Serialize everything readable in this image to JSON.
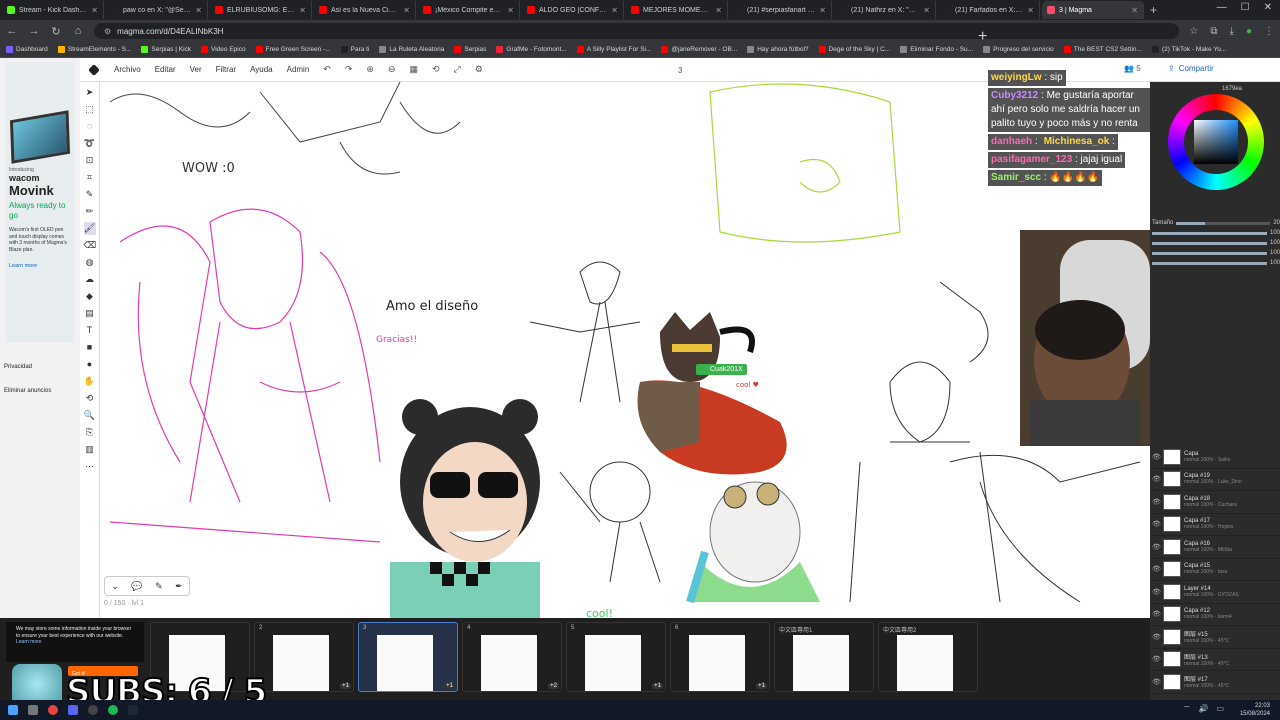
{
  "browser": {
    "tabs": [
      {
        "title": "Stream - Kick Dashboard",
        "color": "#53fc18"
      },
      {
        "title": "paw co en X: \"@Serpias h",
        "color": "#222222"
      },
      {
        "title": "ELRUBIUSOMG: El YouTub",
        "color": "#ff0000"
      },
      {
        "title": "Así es la Nueva Ciudad Pr",
        "color": "#ff0000"
      },
      {
        "title": "¡México Compite en las Es",
        "color": "#ff0000"
      },
      {
        "title": "ALDO GEO |CONFRONTA",
        "color": "#ff0000"
      },
      {
        "title": "MEJORES MOMENTOS Ri",
        "color": "#ff0000"
      },
      {
        "title": "(21) #serpiasfanart - Busc",
        "color": "#222222"
      },
      {
        "title": "(21) Nathrz en X: \"El mag",
        "color": "#222222"
      },
      {
        "title": "(21) Farfados en X: \"Tened",
        "color": "#222222"
      },
      {
        "title": "3 | Magma",
        "color": "#ff4a6a",
        "active": true
      }
    ],
    "new_tab": "+",
    "url": "magma.com/d/D4EALINbK3H",
    "bookmarks": [
      {
        "label": "Dashboard",
        "color": "#7b5cff"
      },
      {
        "label": "StreamElements - S...",
        "color": "#ffb400"
      },
      {
        "label": "Serpias | Kick",
        "color": "#53fc18"
      },
      {
        "label": "Video Epico",
        "color": "#ff0000"
      },
      {
        "label": "Free Green Screen -...",
        "color": "#ff0000"
      },
      {
        "label": "Para ti",
        "color": "#222222"
      },
      {
        "label": "La Ruleta Aleatoria",
        "color": "#888888"
      },
      {
        "label": "Serpias",
        "color": "#ff0000"
      },
      {
        "label": "GrafMe - Fotomont...",
        "color": "#e23"
      },
      {
        "label": "A Silly Playlist For Si...",
        "color": "#ff0000"
      },
      {
        "label": "@janeRemover - OB...",
        "color": "#ff0000"
      },
      {
        "label": "Hay ahora fútbol?",
        "color": "#888888"
      },
      {
        "label": "Dege of the Sky | C...",
        "color": "#ff0000"
      },
      {
        "label": "Eliminar Fondo - Su...",
        "color": "#888888"
      },
      {
        "label": "Progreso del servicio",
        "color": "#888888"
      },
      {
        "label": "The BEST CS2 Settin...",
        "color": "#ff0000"
      },
      {
        "label": "(2) TikTok - Make Yo...",
        "color": "#222222"
      }
    ]
  },
  "ad": {
    "intro": "Introducing",
    "brand": "wacom",
    "product": "Movink",
    "slogan": "Always ready to go",
    "body": "Wacom's first OLED pen and touch display comes with 3 months of Magma's Blaze plan.",
    "learn": "Learn more",
    "privacy": "Privacidad",
    "remove": "Eliminar anuncios"
  },
  "app": {
    "menu": [
      "Archivo",
      "Editar",
      "Ver",
      "Filtrar",
      "Ayuda",
      "Admin"
    ],
    "page_number": "3",
    "user_count": "5",
    "share": "Compartir",
    "zoom_info": "0 / 150 · lvl 1",
    "cursor_user": "Cuak201X",
    "add_page": "+"
  },
  "canvas_text": {
    "wow": "WOW :0",
    "amo": "Amo el diseño",
    "gracias": "Gracias!!",
    "cool": "cool!",
    "cool2": "cool ♥"
  },
  "chat": [
    {
      "user": "weiyingLw",
      "msg": "sip",
      "color": "#ffd84a"
    },
    {
      "user": "Cuby3212",
      "msg": "Me gustaría aportar ahí pero solo me saldría hacer un palito tuyo y poco más y no renta",
      "color": "#c48bff"
    },
    {
      "user": "danhaeh",
      "msg": "",
      "color": "#ff69b4"
    },
    {
      "user": "Michinesa_ok",
      "msg": "",
      "color": "#ffd84a"
    },
    {
      "user": "pasifagamer_123",
      "msg": "jajaj igual",
      "color": "#ff69b4"
    },
    {
      "user": "Samir_scc",
      "msg": "🔥🔥🔥🔥",
      "color": "#9ef06b"
    }
  ],
  "color_panel": {
    "hex": "1679ea",
    "size_label": "Tamaño",
    "values": [
      "20",
      "100",
      "100",
      "100",
      "100"
    ]
  },
  "layers": [
    {
      "name": "Capa",
      "mode": "normal 100%",
      "owner": "Saiko"
    },
    {
      "name": "Capa #19",
      "mode": "normal 100%",
      "owner": "Luke_Dino"
    },
    {
      "name": "Capa #18",
      "mode": "normal 100%",
      "owner": "Cuchara"
    },
    {
      "name": "Capa #17",
      "mode": "normal 100%",
      "owner": "Hoplex"
    },
    {
      "name": "Capa #16",
      "mode": "normal 100%",
      "owner": "MtiSta"
    },
    {
      "name": "Capa #15",
      "mode": "normal 100%",
      "owner": "tasu"
    },
    {
      "name": "Layer #14",
      "mode": "normal 100%",
      "owner": "GYOZAS"
    },
    {
      "name": "Capa #12",
      "mode": "normal 100%",
      "owner": "karm4"
    },
    {
      "name": "图层 #15",
      "mode": "normal 100%",
      "owner": "45°C"
    },
    {
      "name": "图层 #13",
      "mode": "normal 100%",
      "owner": "45°C"
    },
    {
      "name": "图层 #17",
      "mode": "normal 100%",
      "owner": "45°C"
    },
    {
      "name": "图层 #12",
      "mode": "normal 100%",
      "owner": "45°C"
    }
  ],
  "pages": [
    {
      "num": "",
      "badge": ""
    },
    {
      "num": "2",
      "badge": "+1"
    },
    {
      "num": "3",
      "badge": "+1",
      "active": true
    },
    {
      "num": "4",
      "badge": "+2"
    },
    {
      "num": "5",
      "badge": "+1"
    },
    {
      "num": "6",
      "badge": "+1"
    },
    {
      "num": "中文區專用1",
      "badge": ""
    },
    {
      "num": "中文區專用2",
      "badge": ""
    }
  ],
  "cookie": {
    "text": "We may store some information inside your browser to ensure your best experience with our website.",
    "link": "Learn more",
    "button": "Got it!"
  },
  "overlay": {
    "subs": "SUBS: 6 / 5"
  },
  "taskbar": {
    "time": "22:03",
    "date": "15/08/2024"
  }
}
